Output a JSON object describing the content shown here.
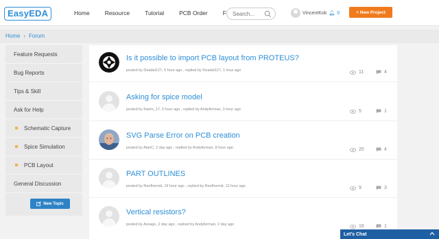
{
  "app": {
    "logo_text": "EasyEDA"
  },
  "nav": {
    "items": [
      "Home",
      "Resource",
      "Tutorial",
      "PCB Order",
      "Forum"
    ]
  },
  "search": {
    "placeholder": "Search..."
  },
  "user": {
    "name": "VincentKok",
    "notifications": "0"
  },
  "toolbar": {
    "new_project_label": "+ New Project"
  },
  "breadcrumb": {
    "home": "Home",
    "current": "Forum"
  },
  "sidebar": {
    "items": [
      {
        "label": "Feature Requests"
      },
      {
        "label": "Bug Reports"
      },
      {
        "label": "Tips & Skill"
      },
      {
        "label": "Ask for Help"
      },
      {
        "label": "Schematic Capture"
      },
      {
        "label": "Spice Simulation"
      },
      {
        "label": "PCB Layout"
      },
      {
        "label": "General Discussion"
      }
    ],
    "new_topic_label": "New Topic"
  },
  "topics": [
    {
      "title": "Is it possible to import PCB layout from PROTEUS?",
      "meta": "posted by Deadal127, 5 hour ago , replied by Deadal127, 1 hour ago",
      "views": "11",
      "replies": "4",
      "avatar": "aperture-logo"
    },
    {
      "title": "Asking for spice model",
      "meta": "posted by Karim_17, 5 hour ago , replied by Andyferman, 3 hour ago",
      "views": "5",
      "replies": "1",
      "avatar": "default"
    },
    {
      "title": "SVG Parse Error on PCB creation",
      "meta": "posted by AlanC, 2 day ago , replied by Andyferman, 8 hour ago",
      "views": "20",
      "replies": "4",
      "avatar": "photo"
    },
    {
      "title": "PART OUTLINES",
      "meta": "posted by Reefhermit, 19 hour ago , replied by Reefhermit, 12 hour ago",
      "views": "9",
      "replies": "3",
      "avatar": "default"
    },
    {
      "title": "Vertical resistors?",
      "meta": "posted by Assago, 2 day ago , replied by Andyferman, 2 day ago",
      "views": "16",
      "replies": "1",
      "avatar": "default"
    }
  ],
  "chat": {
    "label": "Let's Chat"
  },
  "colors": {
    "accent": "#2d8ed6",
    "orange": "#f07b1d",
    "chat": "#1f5fa3",
    "folder_dot": "#f0b34a"
  }
}
